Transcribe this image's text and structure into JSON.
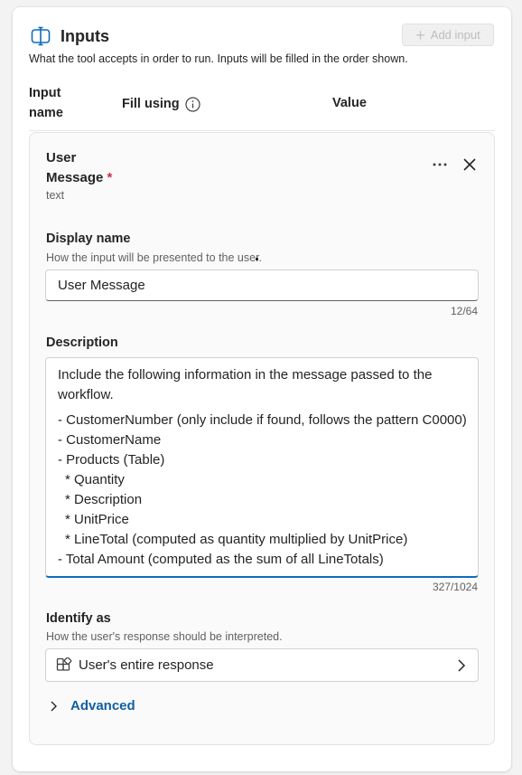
{
  "header": {
    "title": "Inputs",
    "subtitle": "What the tool accepts in order to run. Inputs will be filled in the order shown.",
    "add_button_label": "Add input",
    "icon": "inputs-icon"
  },
  "columns": {
    "input_name": "Input name",
    "fill_using": "Fill using",
    "value": "Value"
  },
  "input_card": {
    "name": "User Message",
    "required_marker": "*",
    "type": "text",
    "display_name": {
      "label": "Display name",
      "hint": "How the input will be presented to the user.",
      "value": "User Message",
      "counter": "12/64"
    },
    "description": {
      "label": "Description",
      "intro": "Include the following information in the message passed to the workflow.",
      "lines": [
        "- CustomerNumber (only include if found, follows the pattern C0000)",
        "- CustomerName",
        "- Products (Table)",
        "  * Quantity",
        "  * Description",
        "  * UnitPrice",
        "  * LineTotal (computed as quantity multiplied by UnitPrice)",
        "- Total Amount (computed as the sum of all LineTotals)"
      ],
      "counter": "327/1024"
    },
    "identify_as": {
      "label": "Identify as",
      "hint": "How the user's response should be interpreted.",
      "value": "User's entire response"
    },
    "advanced_label": "Advanced"
  },
  "colors": {
    "accent": "#0f6cbd",
    "link": "#115ea3",
    "required": "#c4314b"
  }
}
